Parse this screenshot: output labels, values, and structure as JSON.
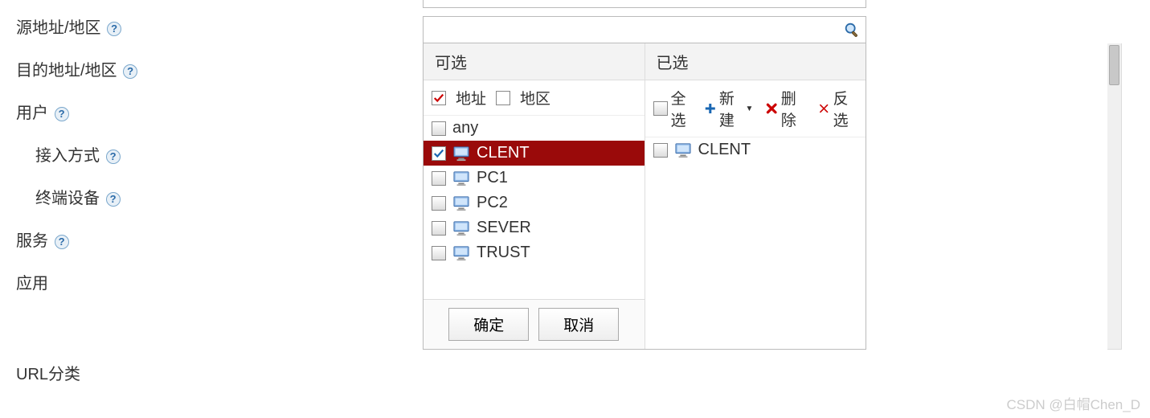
{
  "nav": {
    "src_addr": "源地址/地区",
    "dst_addr": "目的地址/地区",
    "user": "用户",
    "access_mode": "接入方式",
    "terminal": "终端设备",
    "service": "服务",
    "app": "应用",
    "url_cat": "URL分类"
  },
  "search": {
    "placeholder": ""
  },
  "cols": {
    "available": "可选",
    "selected": "已选"
  },
  "filter": {
    "address": {
      "label": "地址",
      "checked": true
    },
    "region": {
      "label": "地区",
      "checked": false
    }
  },
  "toolbar": {
    "select_all": "全选",
    "new": "新建",
    "delete": "删除",
    "invert": "反选"
  },
  "available_items": [
    {
      "name": "any",
      "checked": false,
      "icon": false,
      "selected": false
    },
    {
      "name": "CLENT",
      "checked": true,
      "icon": true,
      "selected": true
    },
    {
      "name": "PC1",
      "checked": false,
      "icon": true,
      "selected": false
    },
    {
      "name": "PC2",
      "checked": false,
      "icon": true,
      "selected": false
    },
    {
      "name": "SEVER",
      "checked": false,
      "icon": true,
      "selected": false
    },
    {
      "name": "TRUST",
      "checked": false,
      "icon": true,
      "selected": false
    }
  ],
  "selected_items": [
    {
      "name": "CLENT",
      "checked": false,
      "icon": true
    }
  ],
  "buttons": {
    "ok": "确定",
    "cancel": "取消"
  },
  "watermark": "CSDN @白帽Chen_D"
}
